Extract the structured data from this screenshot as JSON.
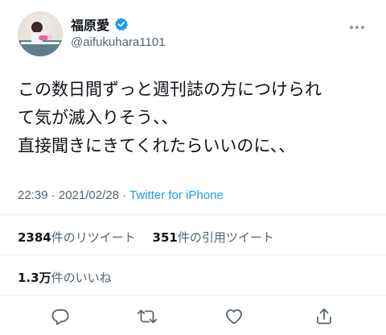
{
  "user": {
    "display_name": "福原愛",
    "handle": "@aifukuhara1101"
  },
  "tweet": {
    "lines": [
      "この数日間ずっと週刊誌の方につけられ",
      "て気が滅入りそう、、",
      "直接聞きにきてくれたらいいのに、、"
    ],
    "time": "22:39",
    "separator": "·",
    "date": "2021/02/28",
    "source": "Twitter for iPhone"
  },
  "stats": {
    "retweets_count": "2384",
    "retweets_label": "件のリツイート",
    "quotes_count": "351",
    "quotes_label": "件の引用ツイート",
    "likes_count": "1.3万",
    "likes_label": "件のいいね"
  },
  "actions": {
    "icons": [
      "reply-icon",
      "retweet-icon",
      "like-icon",
      "share-icon"
    ]
  },
  "colors": {
    "accent": "#1d9bf0",
    "text_primary": "#0f1419",
    "text_secondary": "#536471",
    "divider": "#e6ecf0"
  }
}
